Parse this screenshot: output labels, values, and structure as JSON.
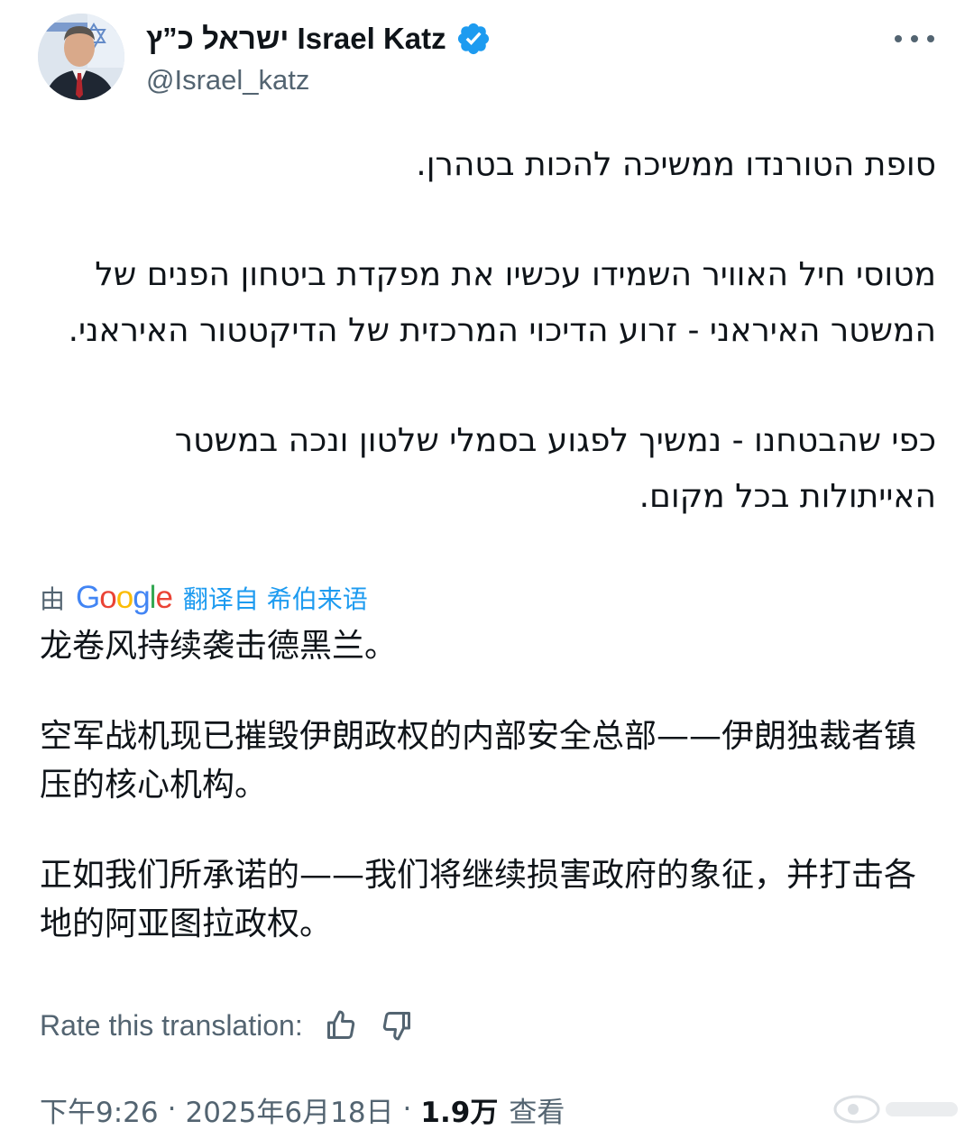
{
  "author": {
    "display_name": "ישראל כ”ץ Israel Katz",
    "handle": "@Israel_katz",
    "verified": true,
    "verified_color": "#1d9bf0"
  },
  "menu": {
    "more_icon": "more-horizontal-icon"
  },
  "post": {
    "language": "he",
    "paragraphs": [
      "סופת הטורנדו ממשיכה להכות בטהרן.",
      "מטוסי חיל האוויר השמידו עכשיו את מפקדת ביטחון הפנים של המשטר האיראני - זרוע הדיכוי המרכזית של הדיקטטור האיראני.",
      "כפי שהבטחנו - נמשיך לפגוע בסמלי שלטון ונכה במשטר האייתולות בכל מקום."
    ]
  },
  "translation": {
    "by_label": "由",
    "provider": "Google",
    "link_label": "翻译自 希伯来语",
    "paragraphs": [
      "龙卷风持续袭击德黑兰。",
      "空军战机现已摧毁伊朗政权的内部安全总部——伊朗独裁者镇压的核心机构。",
      "正如我们所承诺的——我们将继续损害政府的象征，并打击各地的阿亚图拉政权。"
    ],
    "rate_label": "Rate this translation:",
    "rate_icons": [
      "thumbs-up-icon",
      "thumbs-down-icon"
    ]
  },
  "meta": {
    "time": "下午9:26",
    "separator": "·",
    "date": "2025年6月18日",
    "views_count": "1.9万",
    "views_label": "查看"
  },
  "colors": {
    "text_primary": "#0f1419",
    "text_secondary": "#536471",
    "accent": "#1d9bf0"
  }
}
